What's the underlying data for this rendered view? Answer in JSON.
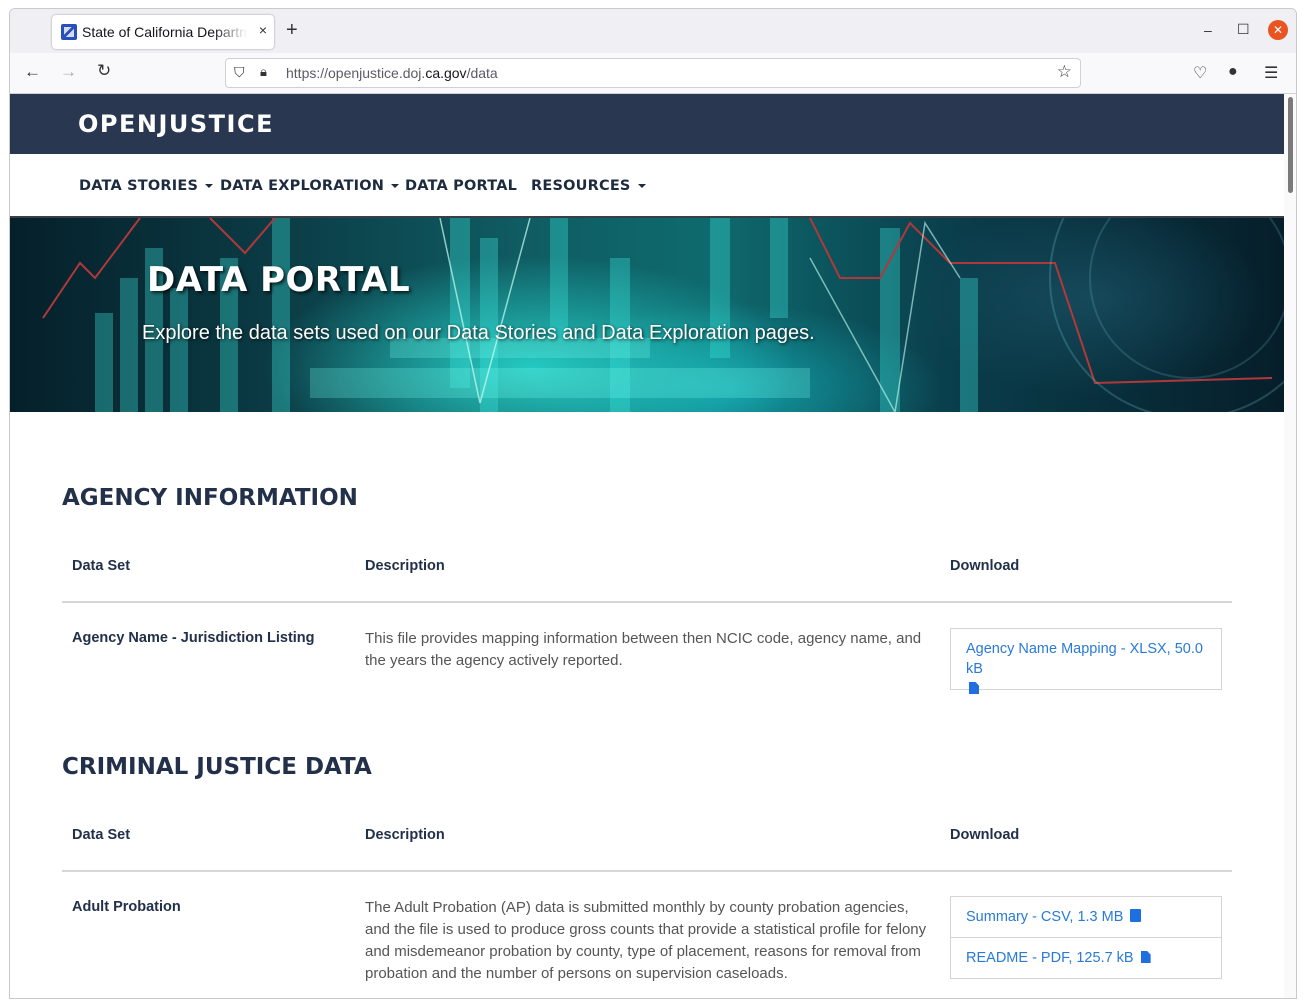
{
  "browser": {
    "tab_title": "State of California Department of Justice",
    "tab_close": "×",
    "new_tab": "+",
    "window_minimize": "–",
    "window_maximize": "☐",
    "window_close": "✕",
    "url_prefix": "https://openjustice.doj.",
    "url_domain": "ca.gov",
    "url_suffix": "/data",
    "back": "←",
    "forward": "→",
    "reload": "↻",
    "star": "☆",
    "menu": "☰"
  },
  "site": {
    "logo": "OPENJUSTICE",
    "nav": [
      {
        "label": "DATA STORIES",
        "dropdown": true
      },
      {
        "label": "DATA EXPLORATION",
        "dropdown": true
      },
      {
        "label": "DATA PORTAL",
        "dropdown": false
      },
      {
        "label": "RESOURCES",
        "dropdown": true
      }
    ]
  },
  "hero": {
    "title": "DATA PORTAL",
    "subtitle": "Explore the data sets used on our Data Stories and Data Exploration pages."
  },
  "table_headers": {
    "dataset": "Data Set",
    "description": "Description",
    "download": "Download"
  },
  "sections": [
    {
      "title": "AGENCY INFORMATION",
      "rows": [
        {
          "name": "Agency Name - Jurisdiction Listing",
          "description": "This file provides mapping information between then NCIC code, agency name, and the years the agency actively reported.",
          "downloads": [
            "Agency Name Mapping - XLSX, 50.0 kB"
          ]
        }
      ]
    },
    {
      "title": "CRIMINAL JUSTICE DATA",
      "rows": [
        {
          "name": "Adult Probation",
          "description": "The Adult Probation (AP) data is submitted monthly by county probation agencies, and the file is used to produce gross counts that provide a statistical profile for felony and misdemeanor probation by county, type of placement, reasons for removal from probation and the number of persons on supervision caseloads.",
          "downloads": [
            "Summary - CSV, 1.3 MB",
            "README - PDF, 125.7 kB"
          ]
        }
      ]
    }
  ],
  "colors": {
    "header_bg": "#293750",
    "heading_text": "#223049",
    "link": "#2a7ad6",
    "browser_close": "#e95420"
  }
}
